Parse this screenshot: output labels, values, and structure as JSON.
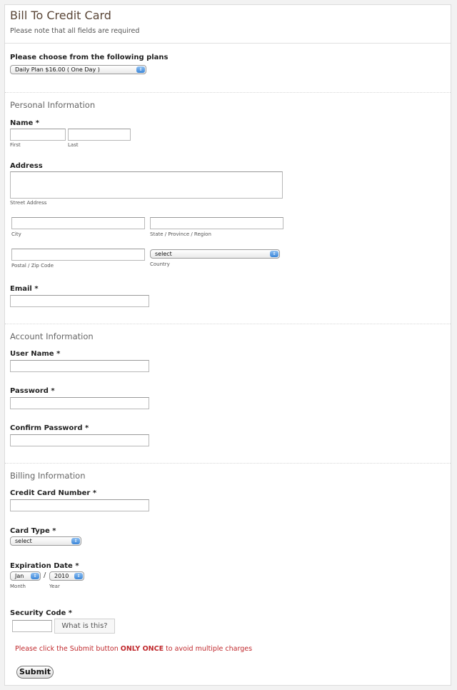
{
  "header": {
    "title": "Bill To Credit Card",
    "subtitle": "Please note that all fields are required"
  },
  "plans": {
    "label": "Please choose from the following plans",
    "selected": "Daily Plan $16.00 ( One Day )"
  },
  "personal": {
    "heading": "Personal Information",
    "name_label": "Name *",
    "first_sub": "First",
    "last_sub": "Last",
    "address_label": "Address",
    "street_sub": "Street Address",
    "city_sub": "City",
    "state_sub": "State / Province / Region",
    "zip_sub": "Postal / Zip Code",
    "country_sub": "Country",
    "country_selected": "select",
    "email_label": "Email *"
  },
  "account": {
    "heading": "Account Information",
    "username_label": "User Name *",
    "password_label": "Password *",
    "confirm_label": "Confirm Password *"
  },
  "billing": {
    "heading": "Billing Information",
    "cc_label": "Credit Card Number *",
    "card_type_label": "Card Type *",
    "card_type_selected": "select",
    "exp_label": "Expiration Date *",
    "month_selected": "Jan",
    "year_selected": "2010",
    "slash": "/",
    "month_sub": "Month",
    "year_sub": "Year",
    "security_label": "Security Code *",
    "what_is_this": "What is this?"
  },
  "footer": {
    "warning_pre": "Please click the Submit button ",
    "warning_bold": "ONLY ONCE",
    "warning_post": " to avoid multiple charges",
    "submit_label": "Submit"
  },
  "icons": {
    "select_arrow": "⇕"
  }
}
